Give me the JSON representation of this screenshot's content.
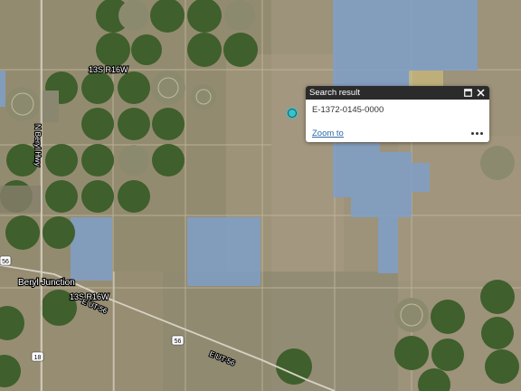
{
  "map": {
    "township_labels": [
      "13S R16W",
      "13S R16W"
    ],
    "road_labels": [
      "N Beryl Hwy",
      "E UT-56",
      "E UT-56"
    ],
    "route_shields": [
      "56",
      "56",
      "18"
    ],
    "place_label": "Beryl Junction",
    "colors": {
      "terrain": "#9a8f72",
      "field_green": "#3f5f2c",
      "parcel_blue": "#7f9fc8",
      "marker": "#36c3d0"
    }
  },
  "popup": {
    "title": "Search result",
    "result_id": "E-1372-0145-0000",
    "zoom_label": "Zoom to",
    "maximize_icon": "maximize-icon",
    "close_icon": "close-icon",
    "more_icon": "ellipsis-icon"
  }
}
